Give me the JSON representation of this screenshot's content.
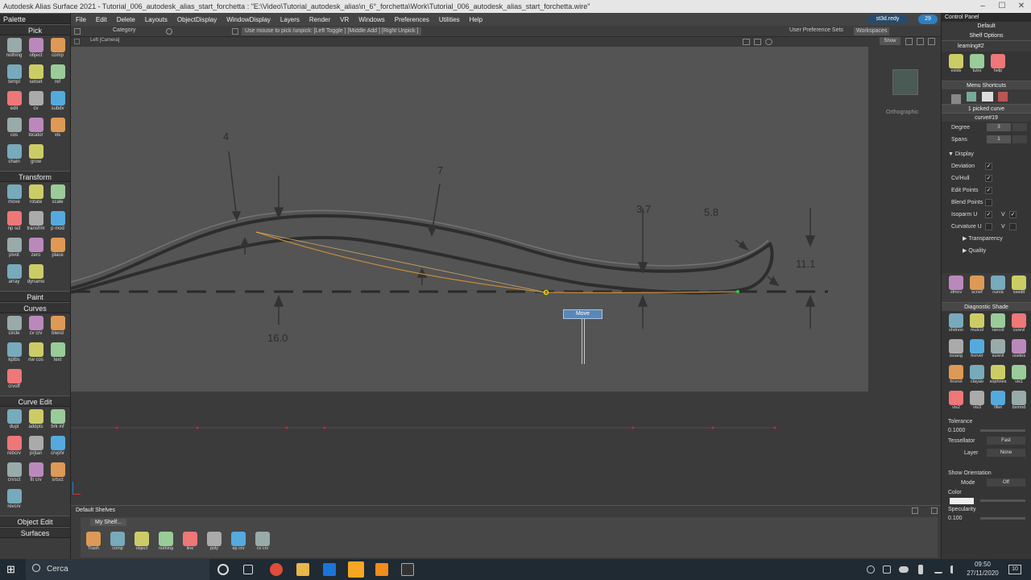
{
  "window": {
    "title": "Autodesk Alias Surface 2021     - Tutorial_006_autodesk_alias_start_forchetta : \"E:\\Video\\Tutorial_autodesk_alias\\n_6°_forchetta\\Work\\Tutorial_006_autodesk_alias_start_forchetta.wire\"",
    "minimize": "–",
    "maximize": "☐",
    "close": "✕"
  },
  "menu": [
    "File",
    "Edit",
    "Delete",
    "Layouts",
    "ObjectDisplay",
    "WindowDisplay",
    "Layers",
    "Render",
    "VR",
    "Windows",
    "Preferences",
    "Utilities",
    "Help"
  ],
  "user": {
    "name": "st3d.redy",
    "badge": "29"
  },
  "control_row": {
    "category": "Category",
    "prompt": "Use mouse to pick /unpick: [Left Toggle ] [Middle Add ] [Right Unpick ]",
    "user_pref": "User Preference Sets",
    "workspaces": "Workspaces",
    "show": "Show"
  },
  "viewport": {
    "camera": "Left [Camera]",
    "cube_label": "Orthographic",
    "move_label": "Move",
    "dims": [
      "4",
      "7",
      "3.7",
      "5.8",
      "11.1",
      "16.0"
    ]
  },
  "palette": {
    "title": "Palette",
    "sections": [
      {
        "name": "Pick",
        "tools": [
          "nothing",
          "object",
          "comp",
          "templ",
          "setset",
          "ref",
          "edit",
          "cv",
          "subdv",
          "cos",
          "locator",
          "vis",
          "chain",
          "grow"
        ]
      },
      {
        "name": "Transform",
        "tools": [
          "move",
          "rotate",
          "scale",
          "np scl",
          "transfrm",
          "p mod",
          "pivot",
          "zero",
          "place",
          "array",
          "dynamo"
        ]
      },
      {
        "name": "Paint",
        "tools": []
      },
      {
        "name": "Curves",
        "tools": [
          "circle",
          "cv crv",
          "blend",
          "kptbs",
          "nw cos",
          "text",
          "crvoff"
        ]
      },
      {
        "name": "Curve Edit",
        "tools": [
          "dupl",
          "addpts",
          "brk inf",
          "rebcrv",
          "prjtan",
          "crvphr",
          "crvsct",
          "fit crv",
          "srtsct",
          "revcrv"
        ]
      },
      {
        "name": "Object Edit",
        "tools": []
      },
      {
        "name": "Surfaces",
        "tools": []
      }
    ]
  },
  "shelves": {
    "title": "Default Shelves",
    "tab": "My Shelf...",
    "tools": [
      "Trash",
      "comp",
      "object",
      "nothing",
      "line",
      "poly",
      "ep crv",
      "cv crv"
    ]
  },
  "control_panel": {
    "title": "Control Panel",
    "default": "Default",
    "shelf_options": "Shelf Options",
    "shelf_name": "learning#2",
    "top_tools": [
      "eslds",
      "tutrs",
      "help"
    ],
    "menu_shortcuts": "Menu Shortcuts",
    "picked": "1 picked curve",
    "curve_name": "curve#19",
    "degree_label": "Degree",
    "degree_value": "3",
    "spans_label": "Spans",
    "spans_value": "1",
    "display": "Display",
    "options": [
      {
        "label": "Deviation",
        "checked": true
      },
      {
        "label": "Cv/Hull",
        "checked": true
      },
      {
        "label": "Edit Points",
        "checked": true
      },
      {
        "label": "Blend Points",
        "checked": false
      },
      {
        "label": "Isoparm U",
        "checked": true,
        "v": "V"
      },
      {
        "label": "Curvature U",
        "checked": false,
        "v": "V"
      }
    ],
    "transparency": "Transparency",
    "quality": "Quality",
    "mid_tools": [
      "sfmcv",
      "scrsrf",
      "curva",
      "ssedit"
    ],
    "diag_title": "Diagnostic Shade",
    "diag_tools": [
      "shdnon",
      "mulcol",
      "rancol",
      "curevl",
      "isoang",
      "horver",
      "surevl",
      "usetes",
      "hrunel",
      "clayao",
      "sophnes",
      "vis1",
      "vis2",
      "vis3",
      "fillet",
      "bsmod"
    ],
    "tolerance_label": "Tolerance",
    "tolerance_value": "0.1000",
    "tessellator_label": "Tessellator",
    "tessellator_value": "Fast",
    "layer_label": "Layer",
    "layer_value": "None",
    "show_orientation": "Show Orientation",
    "mode_label": "Mode",
    "mode_value": "Off",
    "color_label": "Color",
    "specularity_label": "Specularity",
    "specularity_value": "0.100"
  },
  "taskbar": {
    "search": "Cerca",
    "time": "09:50",
    "date": "27/11/2020",
    "notif": "10"
  },
  "colors": {
    "accent": "#2f80c0",
    "curve": "#c88a3a",
    "sketch_bg": "#545454"
  }
}
